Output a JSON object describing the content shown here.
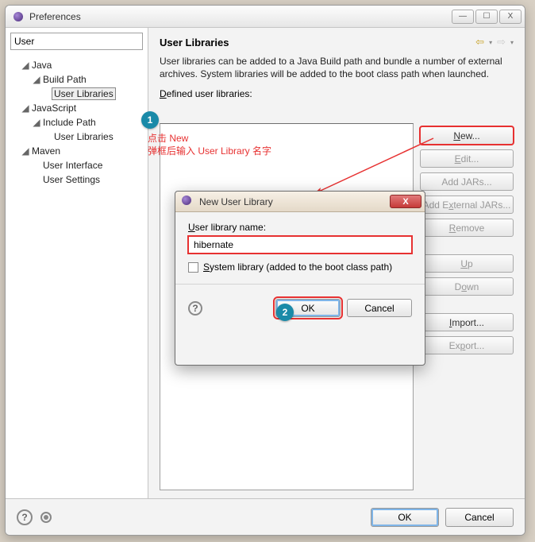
{
  "window": {
    "title": "Preferences",
    "minimize": "—",
    "maximize": "☐",
    "close": "X"
  },
  "filter": {
    "value": "User"
  },
  "tree": {
    "items": [
      {
        "label": "Java",
        "expanded": true,
        "depth": 1
      },
      {
        "label": "Build Path",
        "expanded": true,
        "depth": 2
      },
      {
        "label": "User Libraries",
        "depth": 3,
        "selected": true
      },
      {
        "label": "JavaScript",
        "expanded": true,
        "depth": 1
      },
      {
        "label": "Include Path",
        "expanded": true,
        "depth": 2
      },
      {
        "label": "User Libraries",
        "depth": 3
      },
      {
        "label": "Maven",
        "expanded": true,
        "depth": 1
      },
      {
        "label": "User Interface",
        "depth": 2
      },
      {
        "label": "User Settings",
        "depth": 2
      }
    ]
  },
  "main": {
    "title": "User Libraries",
    "description": "User libraries can be added to a Java Build path and bundle a number of external archives. System libraries will be added to the boot class path when launched.",
    "defined_label_prefix": "D",
    "defined_label_rest": "efined user libraries:"
  },
  "buttons": {
    "new": "New...",
    "edit": "Edit...",
    "add_jars": "Add JARs...",
    "add_ext_jars": "Add External JARs...",
    "remove": "Remove",
    "up": "Up",
    "down": "Down",
    "import": "Import...",
    "export": "Export..."
  },
  "footer": {
    "ok": "OK",
    "cancel": "Cancel"
  },
  "modal": {
    "title": "New User Library",
    "name_label_u": "U",
    "name_label_rest": "ser library name:",
    "name_value": "hibernate",
    "syslib_u": "S",
    "syslib_rest": "ystem library (added to the boot class path)",
    "ok": "OK",
    "cancel": "Cancel"
  },
  "annotations": {
    "badge1": "1",
    "badge2": "2",
    "line1": "点击 New",
    "line2": "弹框后输入 User Library 名字"
  }
}
